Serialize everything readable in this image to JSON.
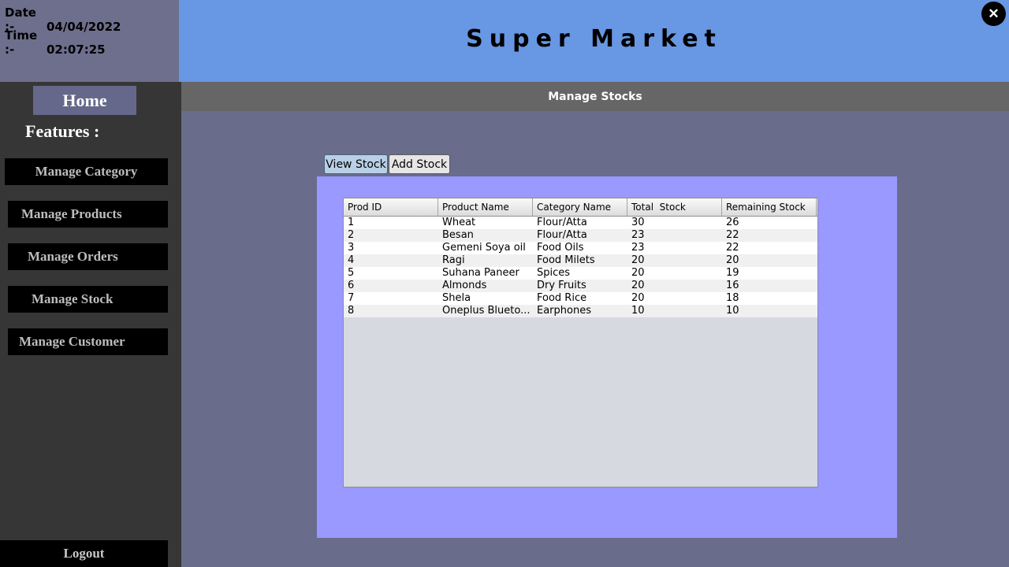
{
  "datetime": {
    "date_label": "Date :-",
    "date_value": "04/04/2022",
    "time_label": "Time :-",
    "time_value": "02:07:25"
  },
  "header": {
    "title": "Super Market",
    "close_icon": "close-icon"
  },
  "sidebar": {
    "home_label": "Home",
    "features_label": "Features :",
    "items": [
      {
        "label": "Manage Category"
      },
      {
        "label": "Manage Products"
      },
      {
        "label": "Manage Orders"
      },
      {
        "label": "Manage Stock"
      },
      {
        "label": "Manage Customer"
      }
    ],
    "logout_label": "Logout"
  },
  "page": {
    "title": "Manage Stocks",
    "tabs": [
      {
        "label": "View Stock",
        "active": true
      },
      {
        "label": "Add Stock",
        "active": false
      }
    ]
  },
  "table": {
    "columns": [
      "Prod ID",
      "Product Name",
      "Category Name",
      "Total  Stock",
      "Remaining Stock"
    ],
    "rows": [
      [
        "1",
        "Wheat",
        "Flour/Atta",
        "30",
        "26"
      ],
      [
        "2",
        "Besan",
        "Flour/Atta",
        "23",
        "22"
      ],
      [
        "3",
        "Gemeni Soya oil",
        "Food Oils",
        "23",
        "22"
      ],
      [
        "4",
        "Ragi",
        "Food Milets",
        "20",
        "20"
      ],
      [
        "5",
        "Suhana Paneer",
        "Spices",
        "20",
        "19"
      ],
      [
        "6",
        "Almonds",
        "Dry Fruits",
        "20",
        "16"
      ],
      [
        "7",
        "Shela",
        "Food Rice",
        "20",
        "18"
      ],
      [
        "8",
        "Oneplus Blueto...",
        "Earphones",
        "10",
        "10"
      ]
    ]
  },
  "colors": {
    "header_bg": "#6897e3",
    "sidebar_bg": "#363636",
    "content_bg": "#9999ff",
    "main_bg": "#696c8b"
  }
}
